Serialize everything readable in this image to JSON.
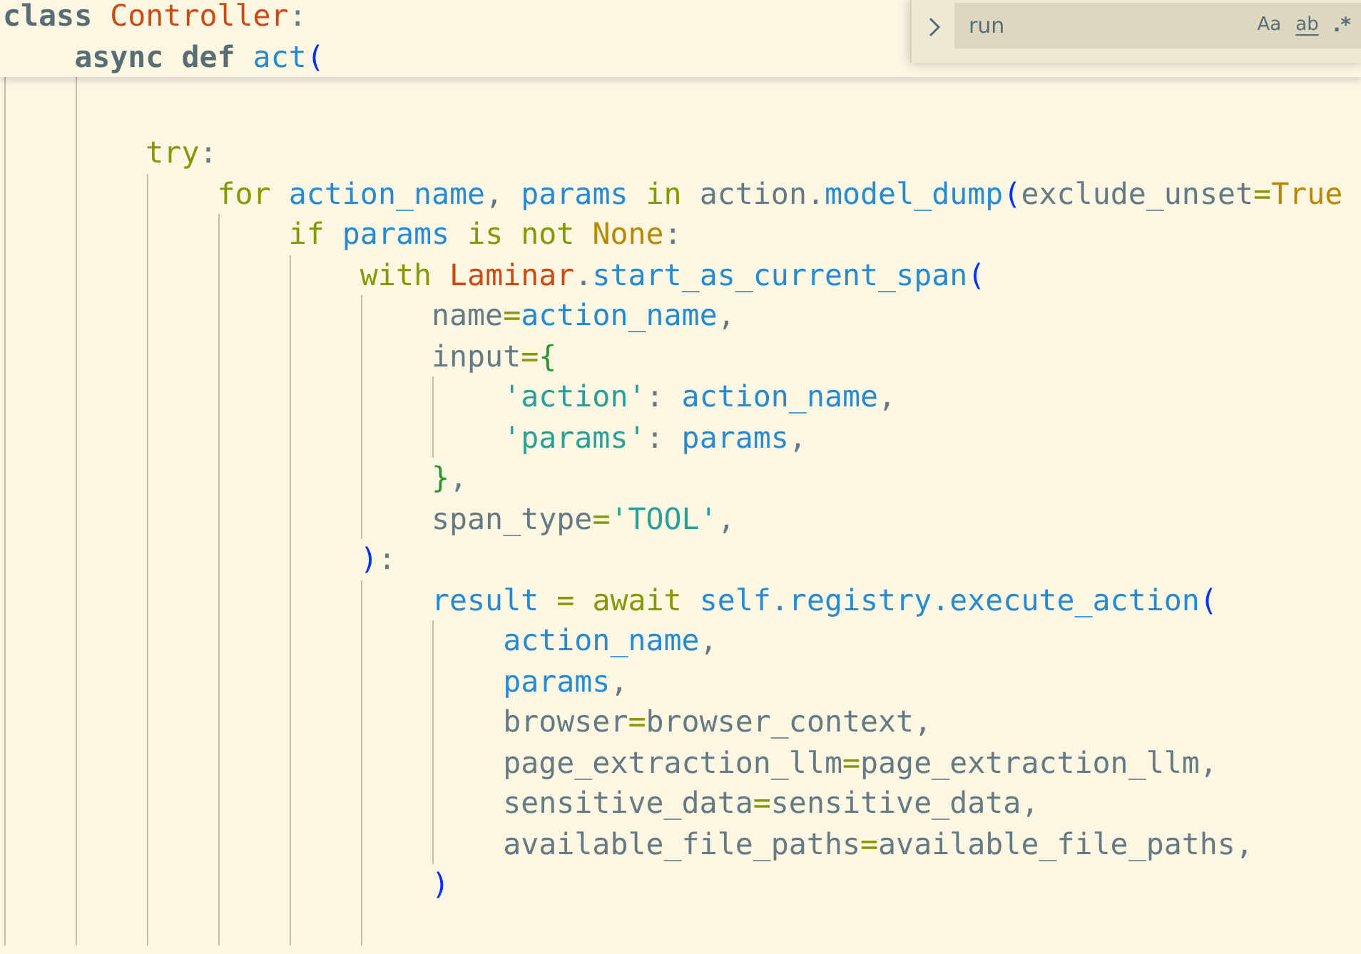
{
  "editor": {
    "sticky_lines": [
      {
        "tokens": [
          {
            "kind": "storage",
            "text": "class "
          },
          {
            "kind": "type",
            "text": "Controller"
          },
          {
            "kind": "plain",
            "text": ":"
          }
        ]
      },
      {
        "tokens": [
          {
            "kind": "storage",
            "text": "    async def "
          },
          {
            "kind": "name",
            "text": "act"
          },
          {
            "kind": "bracket1",
            "text": "("
          }
        ]
      }
    ],
    "lines": [
      {
        "kind": "blank"
      },
      {
        "kind": "blank"
      },
      {
        "kind": "code",
        "tokens": [
          {
            "kind": "keyword",
            "text": "        try"
          },
          {
            "kind": "plain",
            "text": ":"
          }
        ]
      },
      {
        "kind": "code",
        "tokens": [
          {
            "kind": "keyword",
            "text": "            for "
          },
          {
            "kind": "name",
            "text": "action_name"
          },
          {
            "kind": "plain",
            "text": ", "
          },
          {
            "kind": "name",
            "text": "params "
          },
          {
            "kind": "keyword",
            "text": "in "
          },
          {
            "kind": "plain",
            "text": "action."
          },
          {
            "kind": "name",
            "text": "model_dump"
          },
          {
            "kind": "bracket1",
            "text": "("
          },
          {
            "kind": "plain",
            "text": "exclude_unset"
          },
          {
            "kind": "operator",
            "text": "="
          },
          {
            "kind": "constant",
            "text": "True"
          }
        ]
      },
      {
        "kind": "code",
        "tokens": [
          {
            "kind": "keyword",
            "text": "                if "
          },
          {
            "kind": "name",
            "text": "params "
          },
          {
            "kind": "keyword",
            "text": "is not "
          },
          {
            "kind": "constant",
            "text": "None"
          },
          {
            "kind": "plain",
            "text": ":"
          }
        ]
      },
      {
        "kind": "code",
        "tokens": [
          {
            "kind": "keyword",
            "text": "                    with "
          },
          {
            "kind": "type",
            "text": "Laminar"
          },
          {
            "kind": "plain",
            "text": "."
          },
          {
            "kind": "name",
            "text": "start_as_current_span"
          },
          {
            "kind": "bracket1",
            "text": "("
          }
        ]
      },
      {
        "kind": "code",
        "tokens": [
          {
            "kind": "plain",
            "text": "                        name"
          },
          {
            "kind": "operator",
            "text": "="
          },
          {
            "kind": "name",
            "text": "action_name"
          },
          {
            "kind": "plain",
            "text": ","
          }
        ]
      },
      {
        "kind": "code",
        "tokens": [
          {
            "kind": "plain",
            "text": "                        input"
          },
          {
            "kind": "operator",
            "text": "="
          },
          {
            "kind": "bracket2",
            "text": "{"
          }
        ]
      },
      {
        "kind": "code",
        "tokens": [
          {
            "kind": "string",
            "text": "                            'action'"
          },
          {
            "kind": "plain",
            "text": ": "
          },
          {
            "kind": "name",
            "text": "action_name"
          },
          {
            "kind": "plain",
            "text": ","
          }
        ]
      },
      {
        "kind": "code",
        "tokens": [
          {
            "kind": "string",
            "text": "                            'params'"
          },
          {
            "kind": "plain",
            "text": ": "
          },
          {
            "kind": "name",
            "text": "params"
          },
          {
            "kind": "plain",
            "text": ","
          }
        ]
      },
      {
        "kind": "code",
        "tokens": [
          {
            "kind": "bracket2",
            "text": "                        }"
          },
          {
            "kind": "plain",
            "text": ","
          }
        ]
      },
      {
        "kind": "code",
        "tokens": [
          {
            "kind": "plain",
            "text": "                        span_type"
          },
          {
            "kind": "operator",
            "text": "="
          },
          {
            "kind": "string",
            "text": "'TOOL'"
          },
          {
            "kind": "plain",
            "text": ","
          }
        ]
      },
      {
        "kind": "code",
        "tokens": [
          {
            "kind": "bracket1",
            "text": "                    )"
          },
          {
            "kind": "plain",
            "text": ":"
          }
        ]
      },
      {
        "kind": "code",
        "tokens": [
          {
            "kind": "name",
            "text": "                        result "
          },
          {
            "kind": "operator",
            "text": "= "
          },
          {
            "kind": "keyword",
            "text": "await "
          },
          {
            "kind": "name",
            "text": "self.registry.execute_action"
          },
          {
            "kind": "bracket1",
            "text": "("
          }
        ]
      },
      {
        "kind": "code",
        "tokens": [
          {
            "kind": "name",
            "text": "                            action_name"
          },
          {
            "kind": "plain",
            "text": ","
          }
        ]
      },
      {
        "kind": "code",
        "tokens": [
          {
            "kind": "name",
            "text": "                            params"
          },
          {
            "kind": "plain",
            "text": ","
          }
        ]
      },
      {
        "kind": "code",
        "tokens": [
          {
            "kind": "plain",
            "text": "                            browser"
          },
          {
            "kind": "operator",
            "text": "="
          },
          {
            "kind": "plain",
            "text": "browser_context,"
          }
        ]
      },
      {
        "kind": "code",
        "tokens": [
          {
            "kind": "plain",
            "text": "                            page_extraction_llm"
          },
          {
            "kind": "operator",
            "text": "="
          },
          {
            "kind": "plain",
            "text": "page_extraction_llm,"
          }
        ]
      },
      {
        "kind": "code",
        "tokens": [
          {
            "kind": "plain",
            "text": "                            sensitive_data"
          },
          {
            "kind": "operator",
            "text": "="
          },
          {
            "kind": "plain",
            "text": "sensitive_data,"
          }
        ]
      },
      {
        "kind": "code",
        "tokens": [
          {
            "kind": "plain",
            "text": "                            available_file_paths"
          },
          {
            "kind": "operator",
            "text": "="
          },
          {
            "kind": "plain",
            "text": "available_file_paths,"
          }
        ]
      },
      {
        "kind": "code",
        "tokens": [
          {
            "kind": "bracket1",
            "text": "                        )"
          }
        ]
      },
      {
        "kind": "blank"
      }
    ]
  },
  "find_widget": {
    "value": "run",
    "options": [
      {
        "kind": "match_case",
        "label": "Aa",
        "on": false
      },
      {
        "kind": "whole_word",
        "label": "ab",
        "on": false
      },
      {
        "kind": "regex",
        "label": ".*",
        "on": false
      }
    ]
  }
}
